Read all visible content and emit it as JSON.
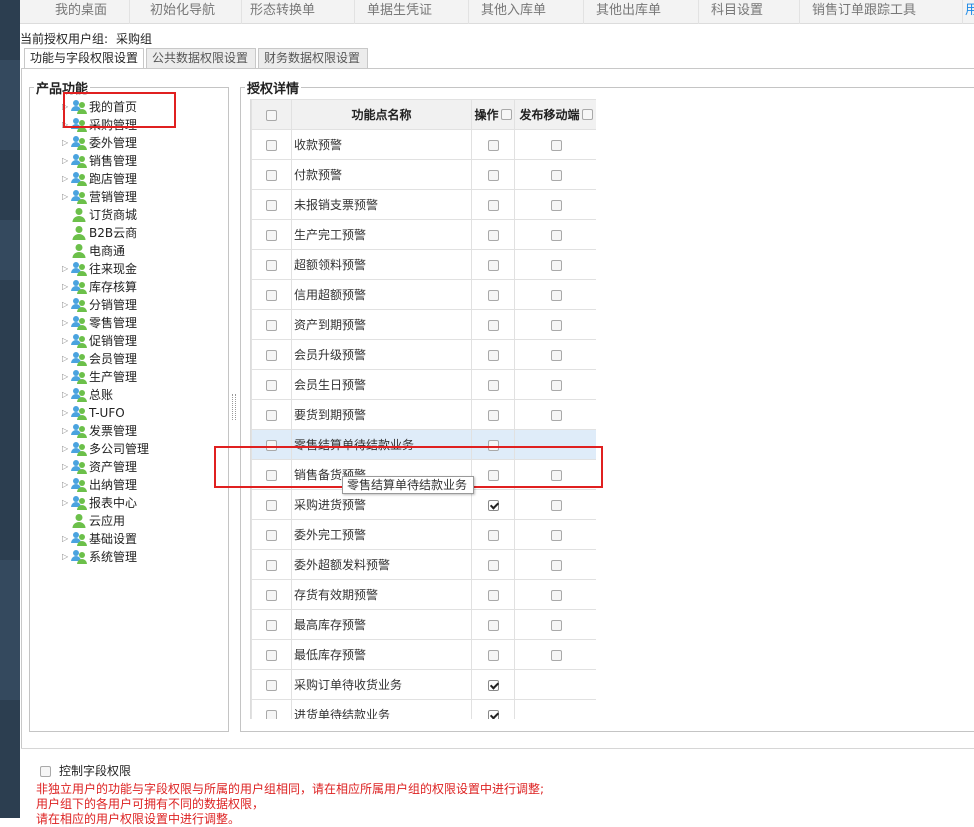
{
  "top_tabs": [
    "我的桌面",
    "初始化导航",
    "形态转换单",
    "单据生凭证",
    "其他入库单",
    "其他出库单",
    "科目设置",
    "销售订单跟踪工具",
    "用"
  ],
  "user_group": {
    "label": "当前授权用户组:",
    "value": "采购组"
  },
  "sub_tabs": [
    "功能与字段权限设置",
    "公共数据权限设置",
    "财务数据权限设置"
  ],
  "tree": {
    "legend": "产品功能",
    "items": [
      {
        "label": "我的首页",
        "expandable": true,
        "icon": "group-icon"
      },
      {
        "label": "采购管理",
        "expandable": true,
        "icon": "group-icon"
      },
      {
        "label": "委外管理",
        "expandable": true,
        "icon": "group-icon"
      },
      {
        "label": "销售管理",
        "expandable": true,
        "icon": "group-icon"
      },
      {
        "label": "跑店管理",
        "expandable": true,
        "icon": "group-icon"
      },
      {
        "label": "营销管理",
        "expandable": true,
        "icon": "group-icon"
      },
      {
        "label": "订货商城",
        "expandable": false,
        "icon": "user-icon"
      },
      {
        "label": "B2B云商",
        "expandable": false,
        "icon": "user-icon"
      },
      {
        "label": "电商通",
        "expandable": false,
        "icon": "user-icon"
      },
      {
        "label": "往来现金",
        "expandable": true,
        "icon": "group-icon"
      },
      {
        "label": "库存核算",
        "expandable": true,
        "icon": "group-icon"
      },
      {
        "label": "分销管理",
        "expandable": true,
        "icon": "group-icon"
      },
      {
        "label": "零售管理",
        "expandable": true,
        "icon": "group-icon"
      },
      {
        "label": "促销管理",
        "expandable": true,
        "icon": "group-icon"
      },
      {
        "label": "会员管理",
        "expandable": true,
        "icon": "group-icon"
      },
      {
        "label": "生产管理",
        "expandable": true,
        "icon": "group-icon"
      },
      {
        "label": "总账",
        "expandable": true,
        "icon": "group-icon"
      },
      {
        "label": "T-UFO",
        "expandable": true,
        "icon": "group-icon"
      },
      {
        "label": "发票管理",
        "expandable": true,
        "icon": "group-icon"
      },
      {
        "label": "多公司管理",
        "expandable": true,
        "icon": "group-icon"
      },
      {
        "label": "资产管理",
        "expandable": true,
        "icon": "group-icon"
      },
      {
        "label": "出纳管理",
        "expandable": true,
        "icon": "group-icon"
      },
      {
        "label": "报表中心",
        "expandable": true,
        "icon": "group-icon"
      },
      {
        "label": "云应用",
        "expandable": false,
        "icon": "user-icon"
      },
      {
        "label": "基础设置",
        "expandable": true,
        "icon": "group-icon"
      },
      {
        "label": "系统管理",
        "expandable": true,
        "icon": "group-icon"
      }
    ]
  },
  "detail": {
    "legend": "授权详情",
    "headers": {
      "name": "功能点名称",
      "op": "操作",
      "mobile": "发布移动端"
    },
    "rows": [
      {
        "name": "收款预警",
        "op": false,
        "mobile": false
      },
      {
        "name": "付款预警",
        "op": false,
        "mobile": false
      },
      {
        "name": "未报销支票预警",
        "op": false,
        "mobile": false
      },
      {
        "name": "生产完工预警",
        "op": false,
        "mobile": false
      },
      {
        "name": "超额领料预警",
        "op": false,
        "mobile": false
      },
      {
        "name": "信用超额预警",
        "op": false,
        "mobile": false
      },
      {
        "name": "资产到期预警",
        "op": false,
        "mobile": false
      },
      {
        "name": "会员升级预警",
        "op": false,
        "mobile": false
      },
      {
        "name": "会员生日预警",
        "op": false,
        "mobile": false
      },
      {
        "name": "要货到期预警",
        "op": false,
        "mobile": false
      },
      {
        "name": "零售结算单待结款业务",
        "op": false,
        "mobile": null,
        "highlight": true
      },
      {
        "name": "销售备货预警",
        "op": false,
        "mobile": false
      },
      {
        "name": "采购进货预警",
        "op": true,
        "mobile": false
      },
      {
        "name": "委外完工预警",
        "op": false,
        "mobile": false
      },
      {
        "name": "委外超额发料预警",
        "op": false,
        "mobile": false
      },
      {
        "name": "存货有效期预警",
        "op": false,
        "mobile": false
      },
      {
        "name": "最高库存预警",
        "op": false,
        "mobile": false
      },
      {
        "name": "最低库存预警",
        "op": false,
        "mobile": false
      },
      {
        "name": "采购订单待收货业务",
        "op": true,
        "mobile": null
      },
      {
        "name": "进货单待结款业务",
        "op": true,
        "mobile": null
      }
    ]
  },
  "tooltip": "零售结算单待结款业务",
  "control_field": "控制字段权限",
  "notes": [
    "非独立用户的功能与字段权限与所属的用户组相同，请在相应所属用户组的权限设置中进行调整;",
    "用户组下的各用户可拥有不同的数据权限，",
    "请在相应的用户权限设置中进行调整。"
  ],
  "colors": {
    "accent": "#1e8ae6",
    "annotation": "#e02020",
    "note_text": "#dd2222"
  }
}
